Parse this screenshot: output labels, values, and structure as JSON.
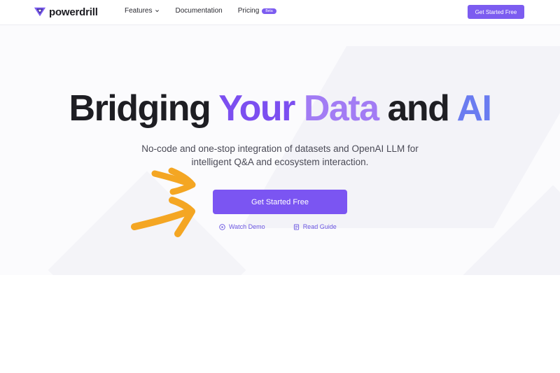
{
  "brand": {
    "name": "powerdrill",
    "color": "#7c5cf0"
  },
  "nav": {
    "items": [
      {
        "label": "Features",
        "has_dropdown": true
      },
      {
        "label": "Documentation",
        "has_dropdown": false
      },
      {
        "label": "Pricing",
        "badge": "Beta"
      }
    ],
    "cta_label": "Get Started Free"
  },
  "hero": {
    "headline": {
      "part1": "Bridging",
      "part2": "Your",
      "part3": "Data",
      "part4": "and",
      "part5": "AI"
    },
    "subtitle_line1": "No-code and one-stop integration of datasets and OpenAI LLM for",
    "subtitle_line2": "intelligent Q&A and ecosystem interaction.",
    "cta_label": "Get Started Free",
    "secondary_links": [
      {
        "label": "Watch Demo",
        "icon": "play-circle-icon"
      },
      {
        "label": "Read Guide",
        "icon": "document-icon"
      }
    ]
  },
  "annotations": {
    "arrow_color": "#f4a623"
  }
}
